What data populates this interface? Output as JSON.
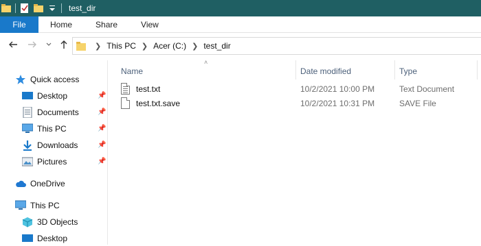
{
  "window": {
    "title": "test_dir"
  },
  "ribbon": {
    "tabs": [
      "File",
      "Home",
      "Share",
      "View"
    ]
  },
  "address": {
    "crumbs": [
      "This PC",
      "Acer (C:)",
      "test_dir"
    ]
  },
  "nav": {
    "quick_access": "Quick access",
    "pinned": [
      "Desktop",
      "Documents",
      "This PC",
      "Downloads",
      "Pictures"
    ],
    "onedrive": "OneDrive",
    "this_pc": "This PC",
    "this_pc_children": [
      "3D Objects",
      "Desktop"
    ]
  },
  "columns": {
    "name": "Name",
    "date": "Date modified",
    "type": "Type"
  },
  "files": [
    {
      "name": "test.txt",
      "date": "10/2/2021 10:00 PM",
      "type": "Text Document"
    },
    {
      "name": "test.txt.save",
      "date": "10/2/2021 10:31 PM",
      "type": "SAVE File"
    }
  ],
  "colors": {
    "titlebar": "#1f5f63",
    "file_tab": "#1979ca",
    "header_text": "#4c607a"
  }
}
